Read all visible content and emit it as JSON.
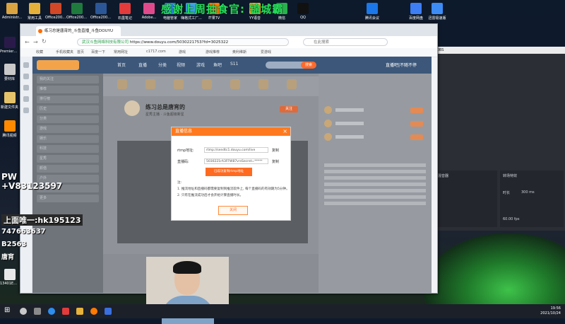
{
  "desktop": {
    "icons": [
      {
        "label": "Administr...",
        "color": "#d9a441"
      },
      {
        "label": "常用工具",
        "color": "#e7b23a"
      },
      {
        "label": "Office2007...",
        "color": "#d24726"
      },
      {
        "label": "Office2007...",
        "color": "#1f7a3d"
      },
      {
        "label": "Office2007...",
        "color": "#2b5797"
      },
      {
        "label": "石墨笔记",
        "color": "#e33b3b"
      },
      {
        "label": "Adobe...",
        "color": "#e04a8c"
      },
      {
        "label": "电脑管家",
        "color": "#2d8ef0"
      },
      {
        "label": "嗨格式工厂...",
        "color": "#3aa3e0"
      },
      {
        "label": "芒果TV",
        "color": "#ff7a00"
      },
      {
        "label": "YY语音",
        "color": "#f6c21c"
      },
      {
        "label": "微信",
        "color": "#2ab04d"
      },
      {
        "label": "QQ",
        "color": "#111111"
      },
      {
        "label": "腾讯会议",
        "color": "#1c77e8"
      },
      {
        "label": "百度网盘",
        "color": "#3d7ef5"
      },
      {
        "label": "迅雷极速版",
        "color": "#3d8cf5"
      }
    ],
    "left_icons": [
      {
        "label": "Premiere CC2019",
        "color": "#2a1a4a"
      },
      {
        "label": "要材库",
        "color": "#c9c9c9"
      },
      {
        "label": "新建文件夹",
        "color": "#e5c36a"
      },
      {
        "label": "腾讯视频",
        "color": "#ff8a00"
      },
      {
        "label": "13401E14...",
        "color": "#e8e8e8"
      }
    ]
  },
  "overlays": {
    "top_banner": "感谢上周抽食官: 锦城霸",
    "left_lines": [
      "PW",
      "+V83123597",
      "上面唯一:hk195123",
      "747663637",
      "B2563",
      "唐宵"
    ]
  },
  "browser": {
    "tab_title": "练习总是唐宵的_斗鱼直播_斗鱼DOUYU",
    "url": "https://www.douyu.com/5030221753?fd=3025322",
    "org_label": "武汉斗鱼网络科技有限公司",
    "search_placeholder": "在此搜索",
    "bookmarks": [
      "收藏",
      "手机收藏夹",
      "首页",
      "百度一下",
      "常用网址",
      "c1717.com",
      "游戏",
      "游戏推荐",
      "奥利维斯",
      "爱游戏"
    ]
  },
  "douyu": {
    "nav": [
      "首页",
      "直播",
      "分类",
      "视频",
      "游戏",
      "鱼吧",
      "S11"
    ],
    "search_button": "搜索",
    "right_text": "直播吧|不随不停",
    "room_title": "练习总是唐宵的",
    "room_sub": "星秀主播 · 斗鱼超级新星",
    "sidebar_rows": [
      "我的关注",
      "推荐",
      "排行榜",
      "历史",
      "分类",
      "游戏",
      "娱乐",
      "科技",
      "星秀",
      "颜值",
      "户外",
      "音乐",
      "更多"
    ],
    "follow_button": "关注"
  },
  "dialog": {
    "title": "直播信息",
    "rtmp_label": "rtmp地址:",
    "rtmp_value": "rtmp://sendtc1.douyu.com/live",
    "code_label": "直播码:",
    "code_value": "5030221rA3FFW87vrsSecret=*****",
    "copy_label": "复制",
    "generate_button": "已成功复制rtmp地址",
    "notes": [
      "注:",
      "1. 推流地址和直播码都需要复制到推流软件上, 每个直播码的有效期为5分钟。",
      "2. 只有在推流成功后才会开始计算直播时长。"
    ],
    "close_button": "关闭"
  },
  "obs": {
    "title": "OBS",
    "panel_a": "混音器",
    "panel_b": "转场特效",
    "fps": "60.00 fps",
    "duration_label": "时长",
    "duration_value": "300 ms"
  },
  "taskbar": {
    "time": "19:56",
    "date": "2021/10/24"
  }
}
